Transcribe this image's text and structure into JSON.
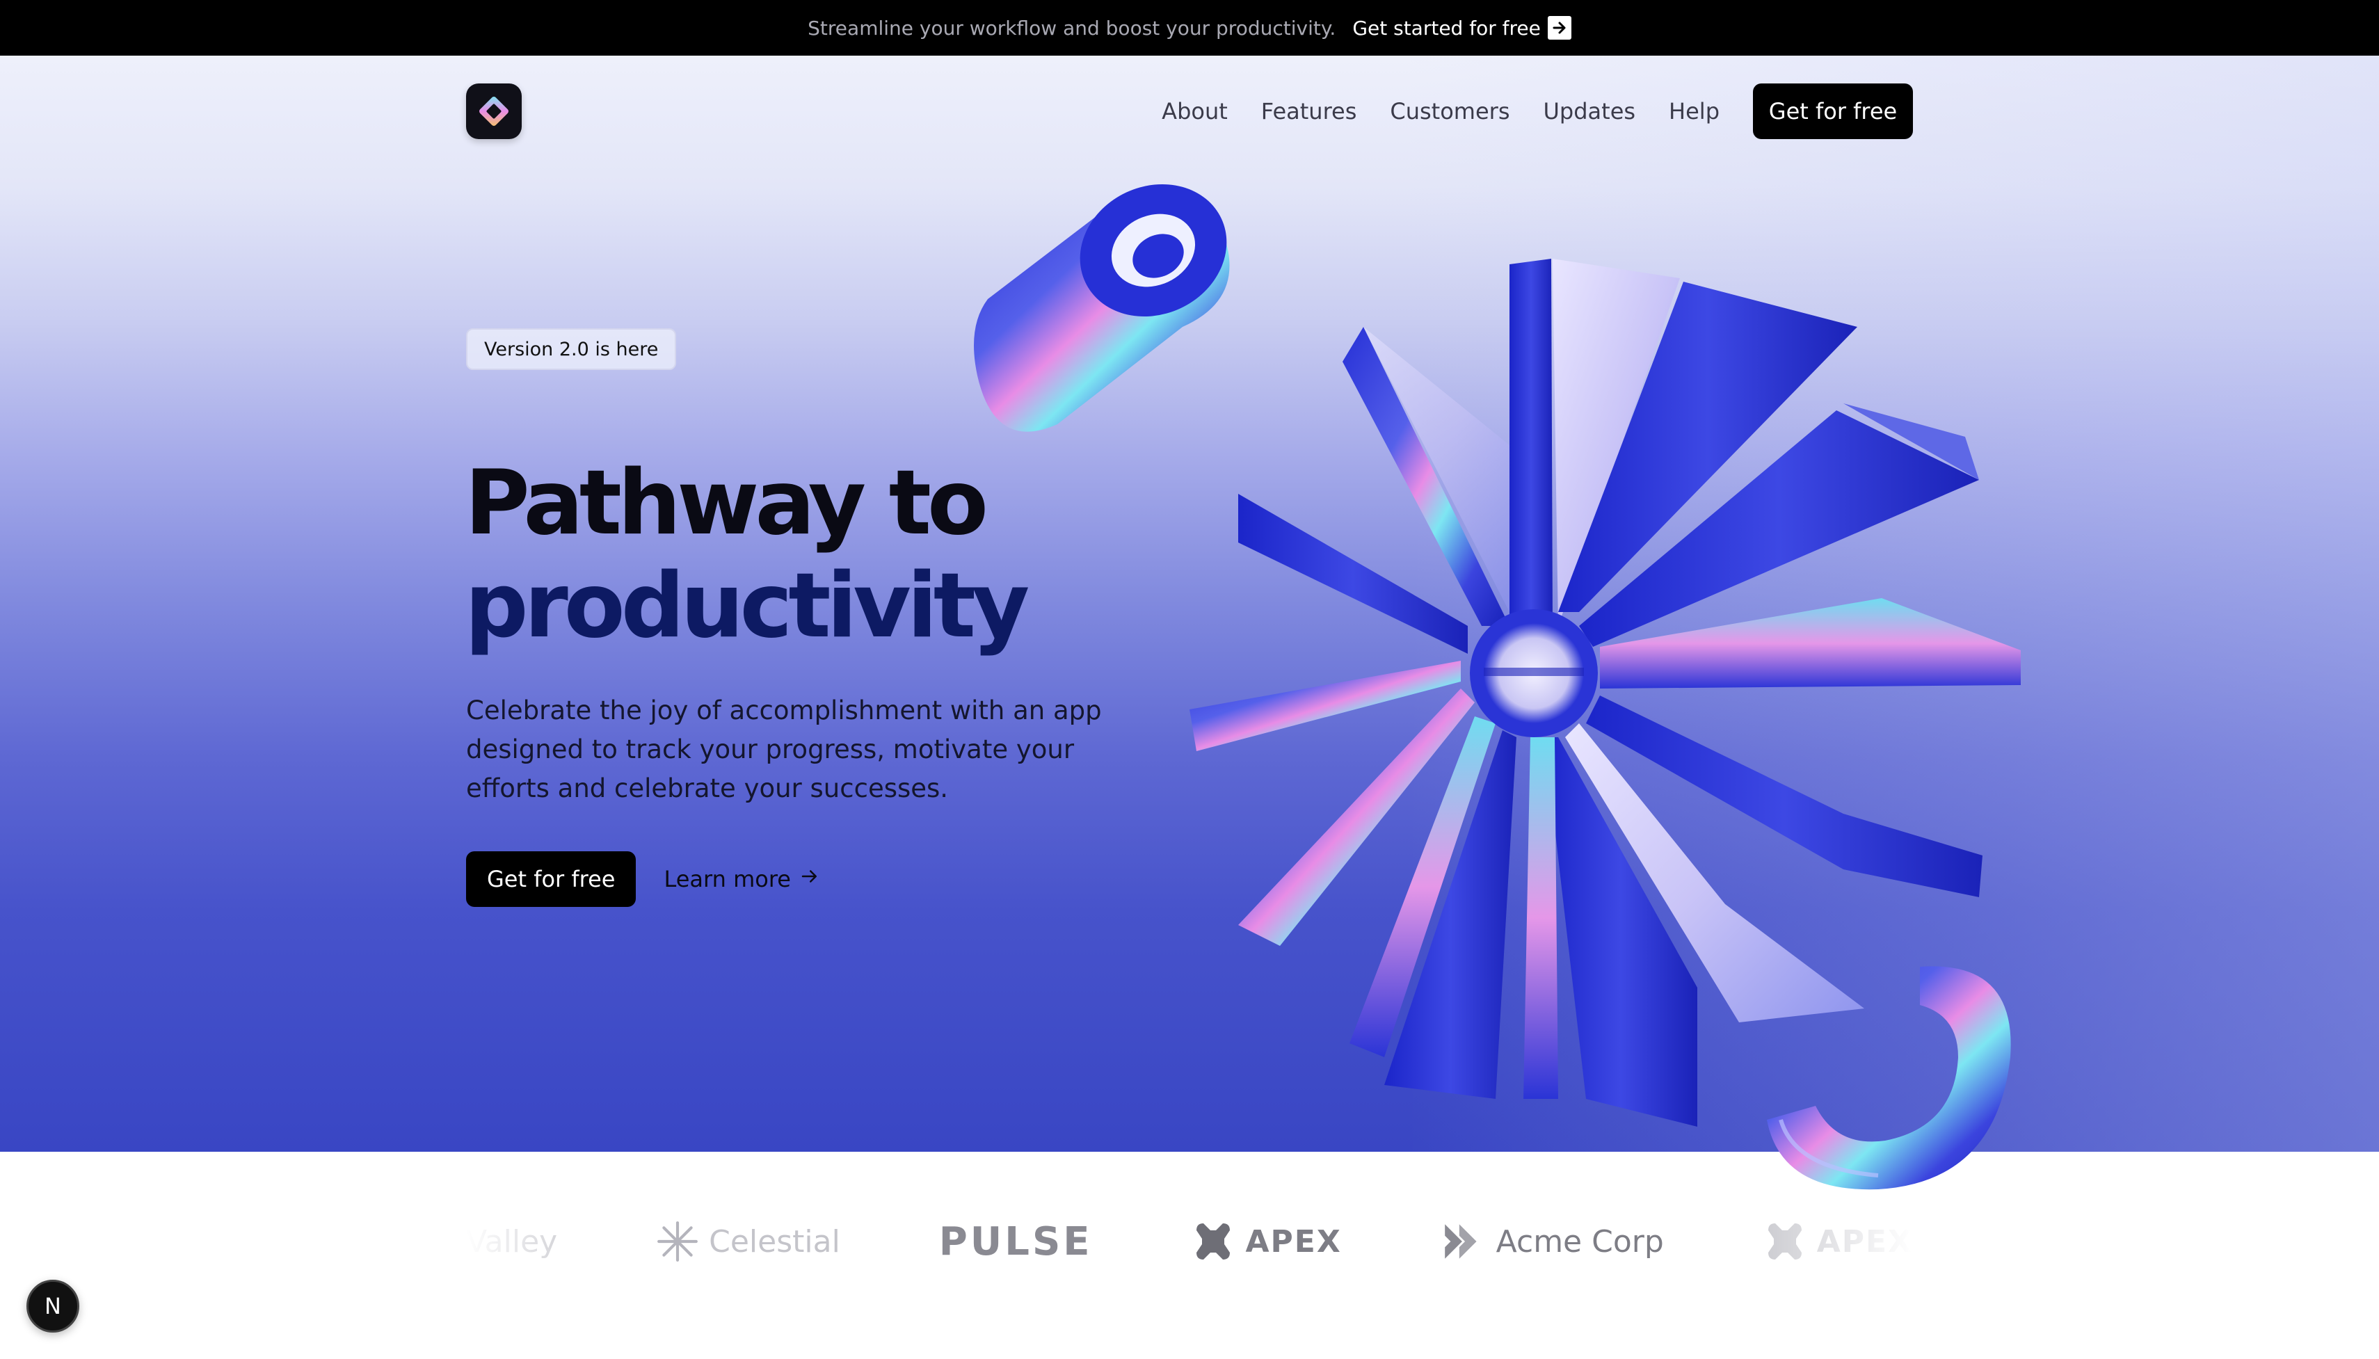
{
  "banner": {
    "text": "Streamline your workflow and boost your productivity.",
    "link_label": "Get started for free",
    "link_icon": "arrow-right-icon"
  },
  "nav": {
    "logo_icon": "diamond-logo-icon",
    "links": [
      "About",
      "Features",
      "Customers",
      "Updates",
      "Help"
    ],
    "cta_label": "Get for free"
  },
  "hero": {
    "badge": "Version 2.0 is here",
    "headline_line1": "Pathway to",
    "headline_line2": "productivity",
    "subcopy": "Celebrate the joy of accomplishment with an app designed to track your progress, motivate your efforts and celebrate your successes.",
    "primary_cta": "Get for free",
    "secondary_cta": "Learn more",
    "secondary_icon": "arrow-right-icon"
  },
  "logos": {
    "items": [
      "Valley",
      "Celestial",
      "PULSE",
      "APEX",
      "Acme Corp",
      "APEX"
    ]
  },
  "floating_button": {
    "label": "N"
  },
  "colors": {
    "accent_blue": "#2a34d8",
    "dark": "#000000",
    "headline_dark": "#0a0a14",
    "headline_navy": "#0d1a63"
  }
}
